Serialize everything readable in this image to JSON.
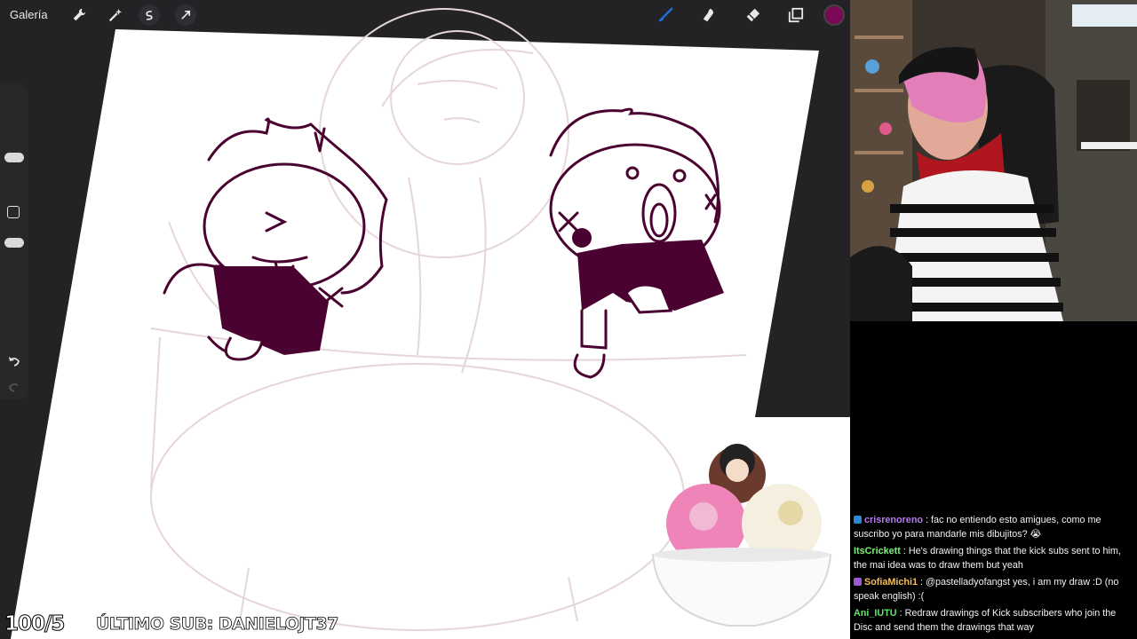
{
  "app": {
    "gallery_label": "Galería",
    "left_tools": [
      "wrench-icon",
      "magic-wand-icon",
      "selection-icon",
      "transform-icon"
    ],
    "right_tools": [
      "brush-icon",
      "smudge-icon",
      "eraser-icon",
      "layers-icon"
    ],
    "active_color": "#7a0a55",
    "accent_tool_color": "#1f6fe0"
  },
  "overlay": {
    "counter": "100/5",
    "last_sub": "ÚLTIMO SUB: DANIELOJT37"
  },
  "chat": {
    "messages": [
      {
        "user": "crisrenoreno",
        "color": "#b57cf0",
        "badge_color": "#2b8ad8",
        "text": "fac no entiendo esto amigues, como me suscribo yo para mandarle mis dibujitos? 😭"
      },
      {
        "user": "ItsCrickett",
        "color": "#7cf07a",
        "badge_color": "",
        "text": "He's drawing things that the kick subs sent to him, the mai idea was to draw them but yeah"
      },
      {
        "user": "SofiaMichi1",
        "color": "#f0c05a",
        "badge_color": "#9a5bd0",
        "text": "@pastelladyofangst yes, i am my draw :D (no speak english) :("
      },
      {
        "user": "Ani_IUTU",
        "color": "#63e36b",
        "badge_color": "",
        "text": "Redraw drawings of Kick subscribers who join the Disc and send them the drawings that way"
      }
    ]
  }
}
